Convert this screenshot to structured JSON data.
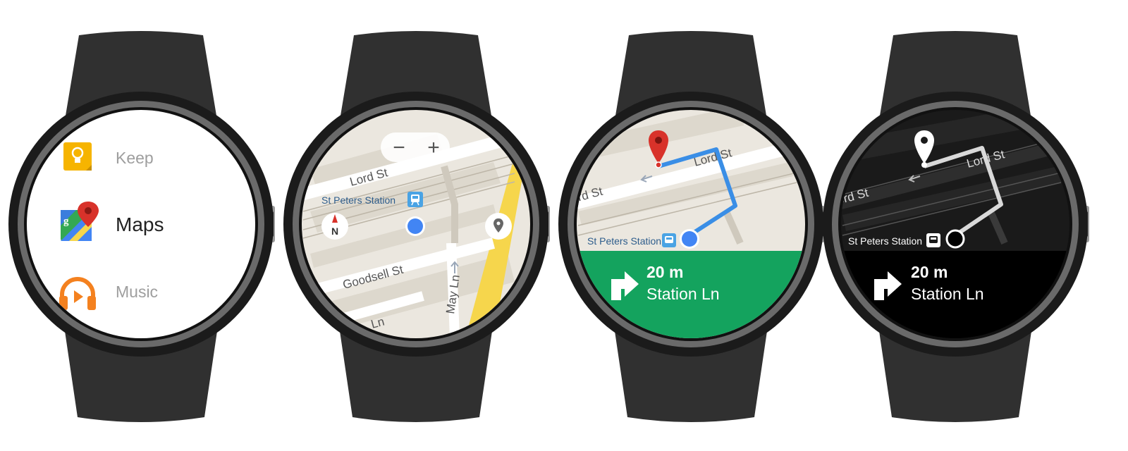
{
  "launcher": {
    "items": [
      {
        "label": "Keep",
        "icon": "keep-icon"
      },
      {
        "label": "Maps",
        "icon": "maps-icon"
      },
      {
        "label": "Music",
        "icon": "music-icon"
      }
    ]
  },
  "map": {
    "streets": {
      "lord": "Lord St",
      "goodsell": "Goodsell St",
      "may": "May Ln",
      "ln_partial": "Ln"
    },
    "station": "St Peters Station",
    "controls": {
      "zoom_out": "−",
      "zoom_in": "+",
      "compass": "N"
    }
  },
  "navigation": {
    "distance": "20 m",
    "street": "Station Ln",
    "turn_direction": "right",
    "lord_label": "Lord St",
    "ord_label": "ord St",
    "station": "St Peters Station"
  },
  "colors": {
    "watch_band": "#303030",
    "bezel": "#1b1b1b",
    "nav_green": "#14a35e",
    "route_blue": "#3a8ee6",
    "location_blue": "#4285f4",
    "pin_red": "#d8322a",
    "map_bg": "#ebe7df",
    "maps_yellow": "#f6d64c"
  }
}
